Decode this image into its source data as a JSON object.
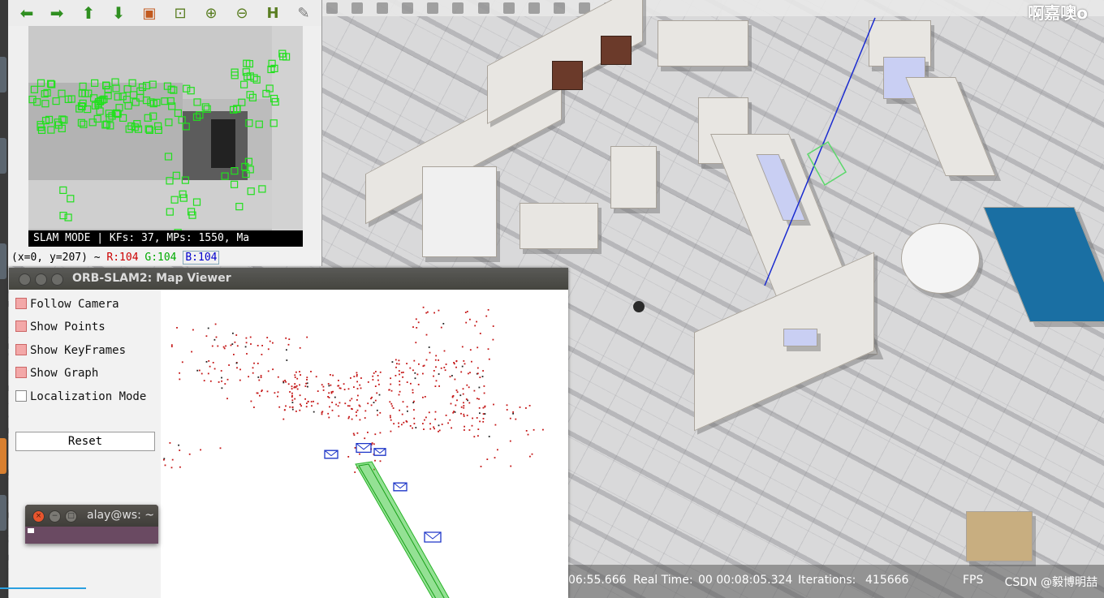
{
  "gazebo": {
    "title_text": "啊嘉噢o",
    "status": {
      "sim_time": "06:55.666",
      "real_time_label": "Real Time:",
      "real_time": "00 00:08:05.324",
      "iterations_label": "Iterations:",
      "iterations": "415666",
      "fps_label": "FPS"
    },
    "watermark": "CSDN @毅博明喆",
    "accent_color": "#e87a1e"
  },
  "image_viewer": {
    "toolbar": [
      {
        "name": "back-arrow-icon",
        "glyph": "⬅"
      },
      {
        "name": "forward-arrow-icon",
        "glyph": "➡"
      },
      {
        "name": "up-arrow-icon",
        "glyph": "⬆"
      },
      {
        "name": "down-arrow-icon",
        "glyph": "⬇"
      },
      {
        "name": "image-icon",
        "glyph": "▣"
      },
      {
        "name": "fit-window-icon",
        "glyph": "⊡"
      },
      {
        "name": "zoom-in-icon",
        "glyph": "⊕"
      },
      {
        "name": "zoom-out-icon",
        "glyph": "⊖"
      },
      {
        "name": "save-icon",
        "glyph": "H"
      },
      {
        "name": "brush-icon",
        "glyph": "✎"
      }
    ],
    "mode_text": "SLAM MODE |  KFs: 37, MPs: 1550, Ma",
    "status": {
      "coords": "(x=0, y=207) ~",
      "r": "R:104",
      "g": "G:104",
      "b": "B:104"
    }
  },
  "map_viewer": {
    "title": "ORB-SLAM2: Map Viewer",
    "options": [
      {
        "label": "Follow Camera",
        "checked": true
      },
      {
        "label": "Show Points",
        "checked": true
      },
      {
        "label": "Show KeyFrames",
        "checked": true
      },
      {
        "label": "Show Graph",
        "checked": true
      },
      {
        "label": "Localization Mode",
        "checked": false
      }
    ],
    "reset_label": "Reset"
  },
  "terminal": {
    "title": "alay@ws: ~"
  }
}
